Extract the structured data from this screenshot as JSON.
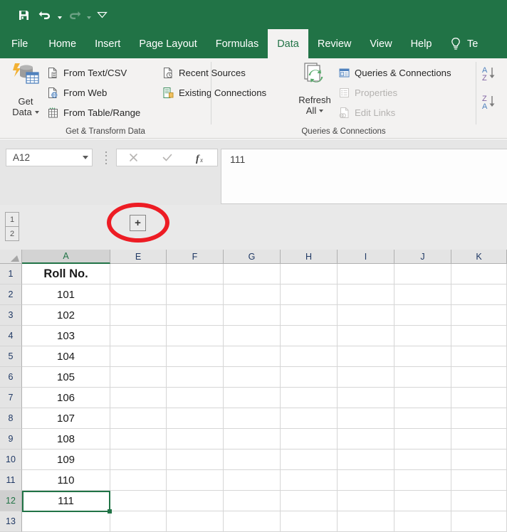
{
  "quick_access": {
    "items": [
      {
        "name": "save",
        "icon": "save-icon",
        "label": "Save",
        "disabled": false
      },
      {
        "name": "undo",
        "icon": "undo-icon",
        "label": "Undo",
        "disabled": false
      },
      {
        "name": "redo",
        "icon": "redo-icon",
        "label": "Redo",
        "disabled": true
      },
      {
        "name": "customize",
        "icon": "customize-quick-access-toolbar-icon",
        "label": "Customize Quick Access Toolbar",
        "disabled": false
      }
    ]
  },
  "ribbon": {
    "tabs": [
      {
        "label": "File",
        "active": false
      },
      {
        "label": "Home",
        "active": false
      },
      {
        "label": "Insert",
        "active": false
      },
      {
        "label": "Page Layout",
        "active": false
      },
      {
        "label": "Formulas",
        "active": false
      },
      {
        "label": "Data",
        "active": true
      },
      {
        "label": "Review",
        "active": false
      },
      {
        "label": "View",
        "active": false
      },
      {
        "label": "Help",
        "active": false
      }
    ],
    "tell_me": "Te",
    "groups": [
      {
        "name": "get-transform-data",
        "label": "Get & Transform Data",
        "big_button": {
          "line1": "Get",
          "line2": "Data",
          "icon": "get-data-icon",
          "has_dropdown": true
        },
        "items": [
          {
            "label": "From Text/CSV",
            "icon": "from-text-csv-icon",
            "disabled": false
          },
          {
            "label": "From Web",
            "icon": "from-web-icon",
            "disabled": false
          },
          {
            "label": "From Table/Range",
            "icon": "from-table-range-icon",
            "disabled": false
          },
          {
            "label": "Recent Sources",
            "icon": "recent-sources-icon",
            "disabled": false
          },
          {
            "label": "Existing Connections",
            "icon": "existing-connections-icon",
            "disabled": false
          }
        ]
      },
      {
        "name": "queries-connections",
        "label": "Queries & Connections",
        "big_button": {
          "line1": "Refresh",
          "line2": "All",
          "icon": "refresh-all-icon",
          "has_dropdown": true
        },
        "items": [
          {
            "label": "Queries & Connections",
            "icon": "queries-connections-icon",
            "disabled": false
          },
          {
            "label": "Properties",
            "icon": "properties-icon",
            "disabled": true
          },
          {
            "label": "Edit Links",
            "icon": "edit-links-icon",
            "disabled": true
          }
        ]
      },
      {
        "name": "sort-filter",
        "label": "",
        "items": [
          {
            "label": "Sort A to Z",
            "icon": "sort-ascending-icon",
            "disabled": false
          },
          {
            "label": "Sort Z to A",
            "icon": "sort-descending-icon",
            "disabled": false
          }
        ]
      }
    ]
  },
  "formula_bar": {
    "name_box_value": "A12",
    "cancel_label": "Cancel",
    "enter_label": "Enter",
    "insert_function_label": "fx",
    "content": "111"
  },
  "outline": {
    "levels": [
      "1",
      "2"
    ],
    "expand_button_label": "+",
    "annotation": {
      "shape": "ellipse",
      "color": "#ED1C24"
    }
  },
  "sheet": {
    "columns": [
      "A",
      "E",
      "F",
      "G",
      "H",
      "I",
      "J",
      "K"
    ],
    "selected_column": "A",
    "rows": [
      "1",
      "2",
      "3",
      "4",
      "5",
      "6",
      "7",
      "8",
      "9",
      "10",
      "11",
      "12",
      "13"
    ],
    "selected_row": "12",
    "active_cell": "A12",
    "column_a_values": [
      "Roll No.",
      "101",
      "102",
      "103",
      "104",
      "105",
      "106",
      "107",
      "108",
      "109",
      "110",
      "111",
      ""
    ]
  },
  "colors": {
    "excel_green": "#217346",
    "ribbon_bg": "#f3f2f1",
    "annotation_red": "#ED1C24"
  }
}
